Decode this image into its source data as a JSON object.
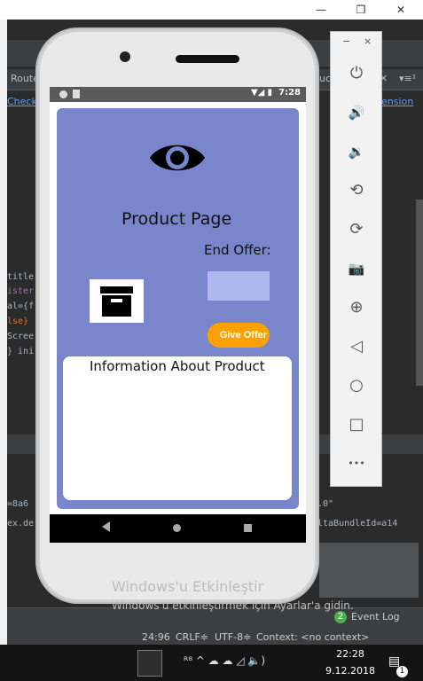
{
  "window": {
    "minimize_glyph": "—",
    "maximize_glyph": "❐",
    "close_glyph": "✕"
  },
  "ide": {
    "tabs": [
      {
        "label": "Route"
      },
      {
        "label": "uc"
      },
      {
        "label": "✕"
      },
      {
        "label": "▾≡¹"
      }
    ],
    "links": [
      {
        "label": "Check f"
      },
      {
        "label": "ension"
      }
    ],
    "code_lines": [
      {
        "text": "title"
      },
      {
        "text": "ister"
      },
      {
        "text": "al={f"
      },
      {
        "text": "lse}"
      },
      {
        "text": "Scree"
      },
      {
        "text": "} ini"
      },
      {
        "text": "=8a6"
      },
      {
        "text": "ex.de"
      },
      {
        "text": ".0\""
      },
      {
        "text": "ltaBundleId=a14"
      }
    ],
    "event_log": {
      "count": "2",
      "label": "Event Log"
    },
    "status": {
      "position": "24:96",
      "line_ending": "CRLF≑",
      "encoding": "UTF-8≑",
      "context": "Context: <no context>"
    }
  },
  "watermark": {
    "line1": "Windows'u Etkinleştir",
    "line2": "Windows'u etkinleştirmek için Ayarlar'a gidin."
  },
  "phone": {
    "status_time": "7:28",
    "status_icons": "▼◢ ▮",
    "app": {
      "title": "Product Page",
      "end_offer_label": "End Offer:",
      "offer_input_value": "",
      "give_offer_label": "Give Offer",
      "info_title": "Information About Product",
      "product_image_icon": "archive-box-icon",
      "eye_icon": "eye-icon"
    },
    "nav": {
      "back": "back-icon",
      "home": "home-icon",
      "recent": "recent-apps-icon"
    }
  },
  "emulator": {
    "minimize": "−",
    "close": "×",
    "buttons": [
      {
        "name": "power-icon",
        "glyph": "⏻"
      },
      {
        "name": "volume-up-icon",
        "glyph": "🔊"
      },
      {
        "name": "volume-down-icon",
        "glyph": "🔉"
      },
      {
        "name": "rotate-left-icon",
        "glyph": "⟲"
      },
      {
        "name": "rotate-right-icon",
        "glyph": "⟳"
      },
      {
        "name": "camera-icon",
        "glyph": "📷"
      },
      {
        "name": "zoom-icon",
        "glyph": "⊕"
      },
      {
        "name": "back-icon",
        "glyph": "◁"
      },
      {
        "name": "home-icon",
        "glyph": "○"
      },
      {
        "name": "overview-icon",
        "glyph": "□"
      },
      {
        "name": "more-icon",
        "glyph": "•••"
      }
    ]
  },
  "taskbar": {
    "time": "22:28",
    "date": "9.12.2018",
    "notification_count": "1",
    "tray_glyphs": "ᴿ⁸  ^  ☁  ☁  ◿  🔈)"
  }
}
